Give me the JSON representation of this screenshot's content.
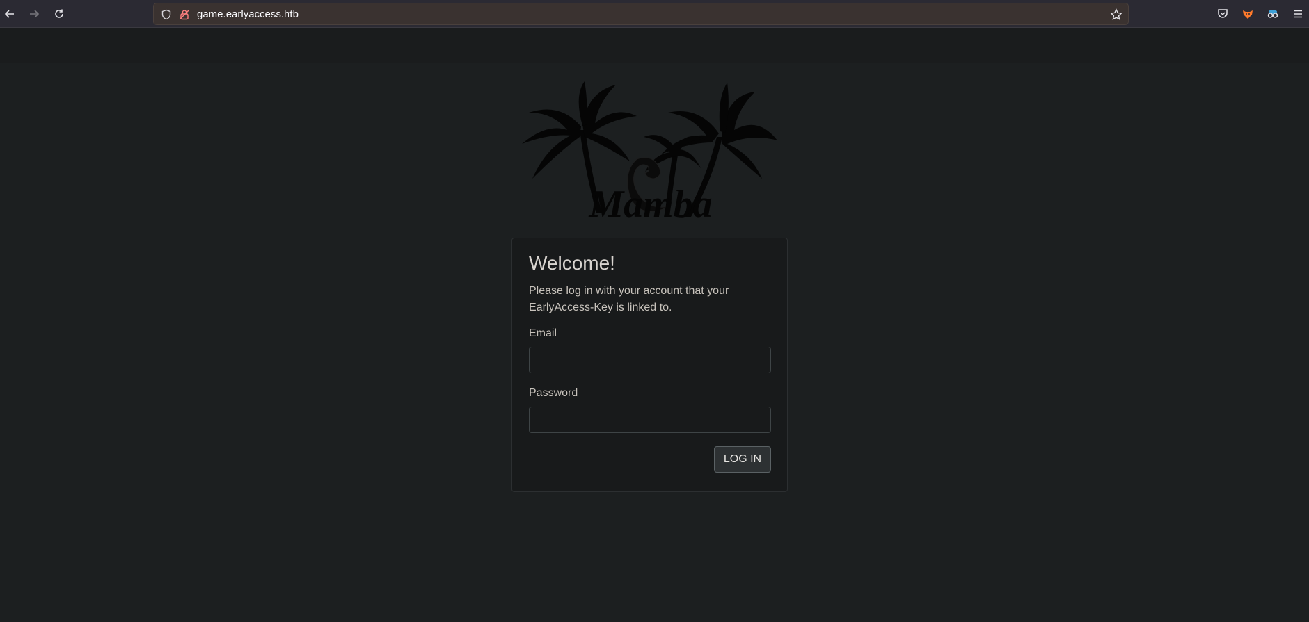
{
  "browser": {
    "url": "game.earlyaccess.htb",
    "back_icon": "arrow-left-icon",
    "forward_icon": "arrow-right-icon",
    "reload_icon": "reload-icon",
    "toolbar_icons": [
      "pocket-icon",
      "extension-fox-icon",
      "extension-mask-icon",
      "hamburger-menu-icon"
    ]
  },
  "logo": {
    "text": "Mamba",
    "icon": "palm-trees-snake-logo"
  },
  "login": {
    "title": "Welcome!",
    "description": "Please log in with your account that your EarlyAccess-Key is linked to.",
    "email_label": "Email",
    "email_value": "",
    "password_label": "Password",
    "password_value": "",
    "submit_label": "LOG IN"
  },
  "colors": {
    "page_background": "#1c1f20",
    "card_background": "#181a1b",
    "text": "#c8c3bc",
    "lock_icon": "#ff8080"
  }
}
